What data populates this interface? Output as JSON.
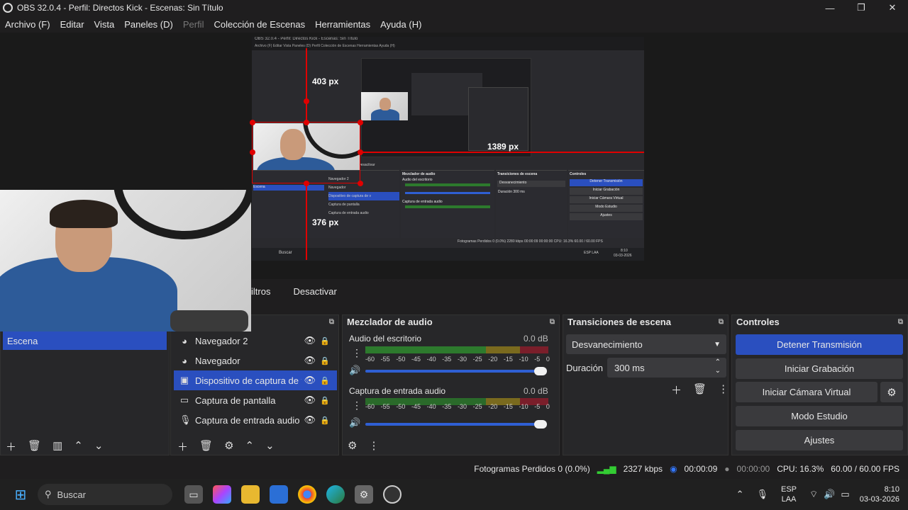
{
  "window": {
    "title": "OBS 32.0.4 - Perfil: Directos Kick - Escenas: Sin Título",
    "minimize": "—",
    "maximize": "❐",
    "close": "✕"
  },
  "menu": {
    "items": [
      "Archivo (F)",
      "Editar",
      "Vista",
      "Paneles (D)",
      "Perfil",
      "Colección de Escenas",
      "Herramientas",
      "Ayuda (H)"
    ]
  },
  "preview": {
    "label_top": "403 px",
    "label_right": "1389 px",
    "label_bottom": "376 px",
    "inner_title": "OBS 32.0.4 - Perfil: Directos Kick - Escenas: Sin Título",
    "inner_menu": "Archivo (F)   Editar   Vista   Paneles (D)   Perfil   Colección de Escenas   Herramientas   Ayuda (H)",
    "inner_docks": [
      "Escena",
      "Mezclador de audio",
      "Transiciones de escena",
      "Controles"
    ],
    "inner_controls": [
      "Detener Transmisión",
      "Iniciar Grabación",
      "Iniciar Cámara Virtual",
      "Modo Estudio",
      "Ajustes"
    ],
    "inner_transition": "Desvanecimiento",
    "inner_duration": "Duración",
    "inner_duration_value": "300 ms",
    "inner_sources": [
      "Navegador 2",
      "Navegador",
      "Dispositivo de captura de v",
      "Captura de pantalla",
      "Captura de entrada audio"
    ],
    "inner_audio": [
      "Audio del escritorio",
      "Captura de entrada audio"
    ],
    "inner_status": "Fotogramas Perdidos 0 (0.0%)   2280 kbps   00:00:09   00:00:00   CPU: 16.3%   60.00 / 60.00 FPS",
    "inner_search": "Buscar",
    "inner_time": "8:10",
    "inner_date": "03-03-2026",
    "inner_lang": "ESP LAA",
    "inner_filters": "Desactivar"
  },
  "filters_row": {
    "filters": "iltros",
    "deactivate": "Desactivar"
  },
  "scenes": {
    "items": [
      "Escena"
    ]
  },
  "sources": {
    "items": [
      {
        "name": "Navegador 2",
        "icon": "globe-icon"
      },
      {
        "name": "Navegador",
        "icon": "globe-icon"
      },
      {
        "name": "Dispositivo de captura de v",
        "icon": "camera-icon"
      },
      {
        "name": "Captura de pantalla",
        "icon": "monitor-icon"
      },
      {
        "name": "Captura de entrada audio",
        "icon": "mic-icon"
      }
    ]
  },
  "mixer": {
    "title": "Mezclador de audio",
    "channels": [
      {
        "name": "Audio del escritorio",
        "db": "0.0 dB"
      },
      {
        "name": "Captura de entrada audio",
        "db": "0.0 dB"
      }
    ],
    "ticks": [
      "-60",
      "-55",
      "-50",
      "-45",
      "-40",
      "-35",
      "-30",
      "-25",
      "-20",
      "-15",
      "-10",
      "-5",
      "0"
    ]
  },
  "transitions": {
    "title": "Transiciones de escena",
    "selected": "Desvanecimiento",
    "duration_label": "Duración",
    "duration_value": "300 ms"
  },
  "controls": {
    "title": "Controles",
    "stop_stream": "Detener Transmisión",
    "start_record": "Iniciar Grabación",
    "start_virtualcam": "Iniciar Cámara Virtual",
    "studio_mode": "Modo Estudio",
    "settings": "Ajustes"
  },
  "status": {
    "dropped": "Fotogramas Perdidos 0 (0.0%)",
    "bitrate": "2327 kbps",
    "stream_time": "00:00:09",
    "rec_time": "00:00:00",
    "cpu": "CPU: 16.3%",
    "fps": "60.00 / 60.00 FPS"
  },
  "taskbar": {
    "search": "Buscar",
    "lang1": "ESP",
    "lang2": "LAA",
    "time": "8:10",
    "date": "03-03-2026"
  },
  "colors": {
    "accent": "#2a4fbf",
    "guide": "#e00000",
    "meter_green": "#2d7a2d",
    "meter_yellow": "#7a6a1e",
    "meter_red": "#7a1e2a"
  }
}
